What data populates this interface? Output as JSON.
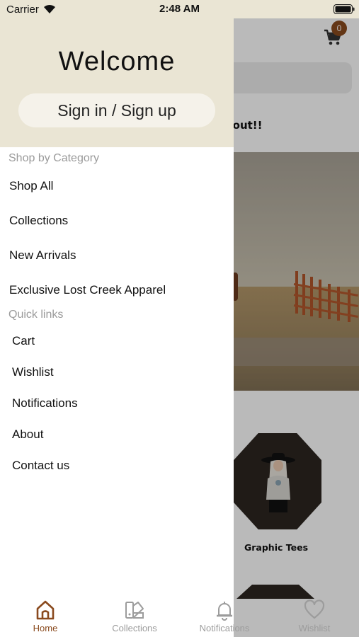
{
  "status_bar": {
    "carrier": "Carrier",
    "time": "2:48 AM"
  },
  "header": {
    "cart_count": "0"
  },
  "home": {
    "promo_text": "eckout!!",
    "category_label": "Graphic Tees"
  },
  "drawer": {
    "welcome": "Welcome",
    "signin_label": "Sign in / Sign up",
    "shop_section_title": "Shop by Category",
    "shop_items": [
      {
        "label": "Shop All"
      },
      {
        "label": "Collections"
      },
      {
        "label": "New Arrivals"
      },
      {
        "label": "Exclusive Lost Creek Apparel"
      }
    ],
    "quick_section_title": "Quick links",
    "quick_items": [
      {
        "label": "Cart"
      },
      {
        "label": "Wishlist"
      },
      {
        "label": "Notifications"
      },
      {
        "label": "About"
      },
      {
        "label": "Contact us"
      }
    ]
  },
  "tabbar": {
    "tabs": [
      {
        "label": "Home",
        "icon": "home-icon",
        "active": true
      },
      {
        "label": "Collections",
        "icon": "collections-icon",
        "active": false
      },
      {
        "label": "Notifications",
        "icon": "bell-icon",
        "active": false
      },
      {
        "label": "Wishlist",
        "icon": "heart-icon",
        "active": false
      }
    ]
  },
  "colors": {
    "accent": "#8a4a1e",
    "drawer_header_bg": "#eae5d4",
    "inactive_tab": "#9c9c9c"
  }
}
